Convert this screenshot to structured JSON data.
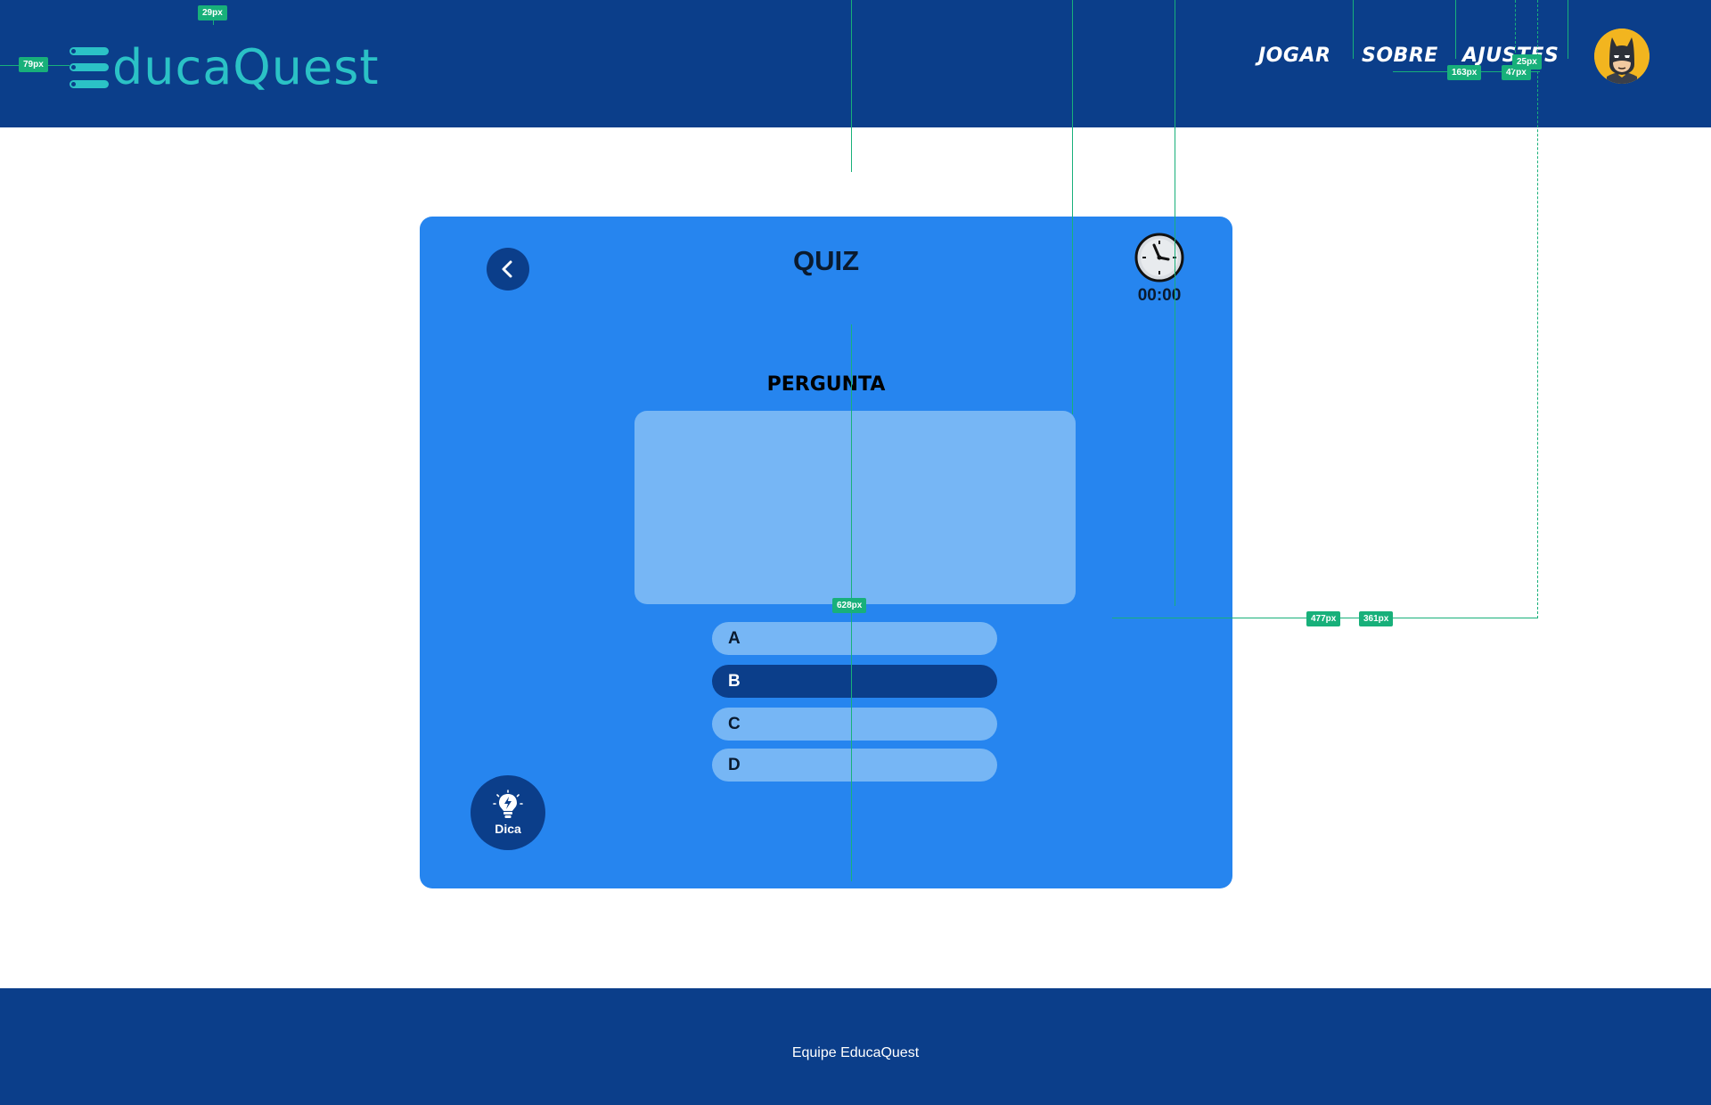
{
  "header": {
    "logo_text": "ducaQuest",
    "nav": {
      "jogar": "JOGAR",
      "sobre": "SOBRE",
      "ajustes": "AJUSTES"
    },
    "avatar_icon": "batman-avatar"
  },
  "quiz": {
    "title": "QUIZ",
    "timer": "00:00",
    "question_label": "PERGUNTA",
    "question_text": "",
    "options": [
      {
        "letter": "A",
        "selected": false
      },
      {
        "letter": "B",
        "selected": true
      },
      {
        "letter": "C",
        "selected": false
      },
      {
        "letter": "D",
        "selected": false
      }
    ],
    "hint_label": "Dica"
  },
  "footer": {
    "text": "Equipe EducaQuest"
  },
  "guides": {
    "tags": [
      "79px",
      "29px",
      "163px",
      "47px",
      "25px",
      "477px",
      "361px",
      "628px"
    ]
  },
  "colors": {
    "header_bg": "#0b3e8a",
    "logo": "#2bc2c6",
    "card_bg": "#2685ef",
    "light_blue": "#76b6f5",
    "guide": "#18b07a"
  }
}
